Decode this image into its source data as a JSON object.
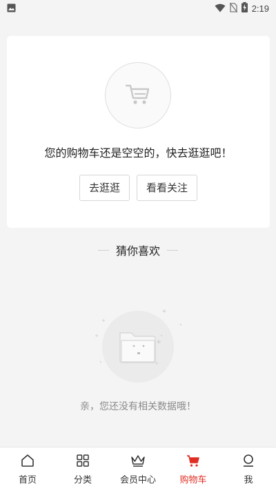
{
  "status_bar": {
    "time": "2:19"
  },
  "cart": {
    "empty_message": "您的购物车还是空空的，快去逛逛吧！",
    "go_shopping_label": "去逛逛",
    "view_follow_label": "看看关注"
  },
  "recommend": {
    "title": "猜你喜欢",
    "empty_text": "亲，您还没有相关数据哦！"
  },
  "tabbar": {
    "items": [
      {
        "label": "首页",
        "icon": "home-icon"
      },
      {
        "label": "分类",
        "icon": "grid-icon"
      },
      {
        "label": "会员中心",
        "icon": "crown-icon"
      },
      {
        "label": "购物车",
        "icon": "cart-icon",
        "active": true
      },
      {
        "label": "我",
        "icon": "user-icon"
      }
    ],
    "active_color": "#e02e24"
  }
}
